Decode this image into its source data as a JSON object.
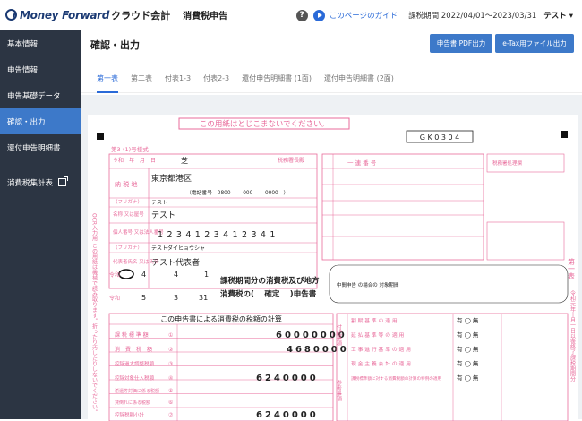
{
  "header": {
    "brand": "Money Forward",
    "product": "クラウド会計",
    "app": "消費税申告",
    "help_icon": "question-icon",
    "guide_icon": "play-icon",
    "guide": "このページのガイド",
    "period": "課税期間 2022/04/01〜2023/03/31",
    "user": "テスト ▾"
  },
  "sidebar": {
    "items": [
      {
        "label": "基本情報"
      },
      {
        "label": "申告情報"
      },
      {
        "label": "申告基礎データ"
      },
      {
        "label": "確認・出力"
      },
      {
        "label": "還付申告明細書"
      },
      {
        "label": "消費税集計表"
      }
    ]
  },
  "main": {
    "title": "確認・出力",
    "pdf_button": "申告書 PDF出力",
    "etax_button": "e-Tax用ファイル出力",
    "tabs": [
      {
        "label": "第一表"
      },
      {
        "label": "第二表"
      },
      {
        "label": "付表1-3"
      },
      {
        "label": "付表2-3"
      },
      {
        "label": "還付申告明細書 (1面)"
      },
      {
        "label": "還付申告明細書 (2面)"
      }
    ]
  },
  "form": {
    "banner": "この用紙はとじこまないでください。",
    "form_code": "G K 0 3 0 4",
    "form_no": "第3-(1)号様式",
    "date_label": "令和　年　月　日",
    "office": "芝",
    "office_suffix": "税務署長殿",
    "address_label": "納 税 地",
    "address": "東京都港区",
    "phone": "（電話番号　0800　-　000　-　0000　）",
    "furigana_label": "（フリガナ）",
    "furigana_name": "テスト",
    "name_label": "名称 又は屋号",
    "name": "テスト",
    "id_label": "個人番号 又は法人番号",
    "id_number": "1234123412341",
    "rep_furigana": "テストダイヒョウシャ",
    "rep_label": "代表者氏名 又は氏名",
    "rep_name": "テスト代表者",
    "from_era": "令和",
    "from_year": "4",
    "from_month": "4",
    "from_day": "1",
    "to_era": "令和",
    "to_year": "5",
    "to_month": "3",
    "to_day": "31",
    "title_line1": "課税期間分の消費税及び地方",
    "title_line2": "消費税の(　 確定 　)申告書",
    "interim_label": "中間申告 の場合の 対象期間",
    "table_title": "この申告書による消費税の税額の計算",
    "rows": [
      {
        "label": "課 税 標 準 額",
        "no": "①",
        "value": "60000000"
      },
      {
        "label": "消　費　税　額",
        "no": "②",
        "value": "4680000"
      },
      {
        "label": "控除過大調整税額",
        "no": "③",
        "value": ""
      },
      {
        "label": "控除対象仕入税額",
        "no": "④",
        "value": "6240000"
      },
      {
        "label": "返還等対価に係る税額",
        "no": "⑤",
        "value": ""
      },
      {
        "label": "貸倒れに係る税額",
        "no": "⑥",
        "value": ""
      },
      {
        "label": "控除税額小計",
        "no": "⑦",
        "value": "6240000"
      }
    ],
    "side_items": [
      {
        "label": "割 賦 基 準 の 適 用",
        "mark": "有 ◯ 無"
      },
      {
        "label": "延 払 基 準 等 の 適 用",
        "mark": "有 ◯ 無"
      },
      {
        "label": "工 事 進 行 基 準 の 適 用",
        "mark": "有 ◯ 無"
      },
      {
        "label": "現 金 主 義 会 計 の 適 用",
        "mark": "有 ◯ 無"
      },
      {
        "label": "課税標準額に対する消費税額の計算の特例の適用",
        "mark": "有 ◯ 無"
      }
    ],
    "side_header": "付記事項",
    "side_header2": "参考事項",
    "right_label": "第一表",
    "serial_label": "一 連 番 号",
    "tax_office_label": "税務署処理欄",
    "ocr_note": "OCR入力用 この用紙は機械で読み取ります。折ったり汚したりしないでください。",
    "right_note": "令和元年十月一日以後終了課税期間分"
  },
  "colors": {
    "accent": "#3d79c9",
    "sidebar": "#2c3543",
    "form_pink": "#e86b9b"
  }
}
